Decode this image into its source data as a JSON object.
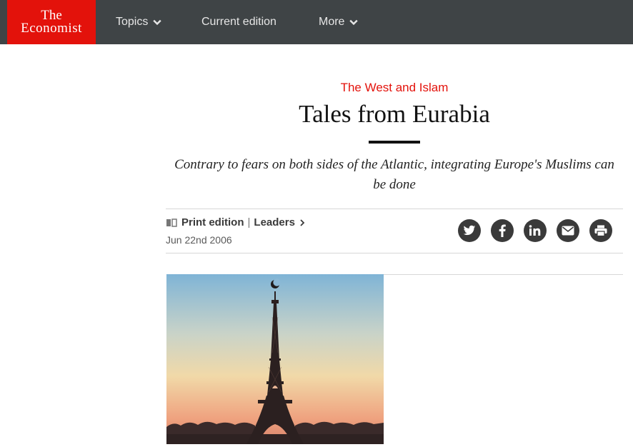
{
  "nav": {
    "logo_line1": "The",
    "logo_line2": "Economist",
    "topics": "Topics",
    "current_edition": "Current edition",
    "more": "More"
  },
  "article": {
    "section": "The West and Islam",
    "headline": "Tales from Eurabia",
    "standfirst": "Contrary to fears on both sides of the Atlantic, integrating Europe's Muslims can be done",
    "print_edition": "Print edition",
    "separator": "|",
    "leaders": "Leaders",
    "date": "Jun 22nd 2006"
  },
  "share": {
    "twitter_icon": "twitter-icon",
    "facebook_icon": "facebook-icon",
    "linkedin_icon": "linkedin-icon",
    "email_icon": "email-icon",
    "print_icon": "print-icon"
  },
  "colors": {
    "brand_red": "#e3120b",
    "nav_bg": "#3f4446"
  }
}
